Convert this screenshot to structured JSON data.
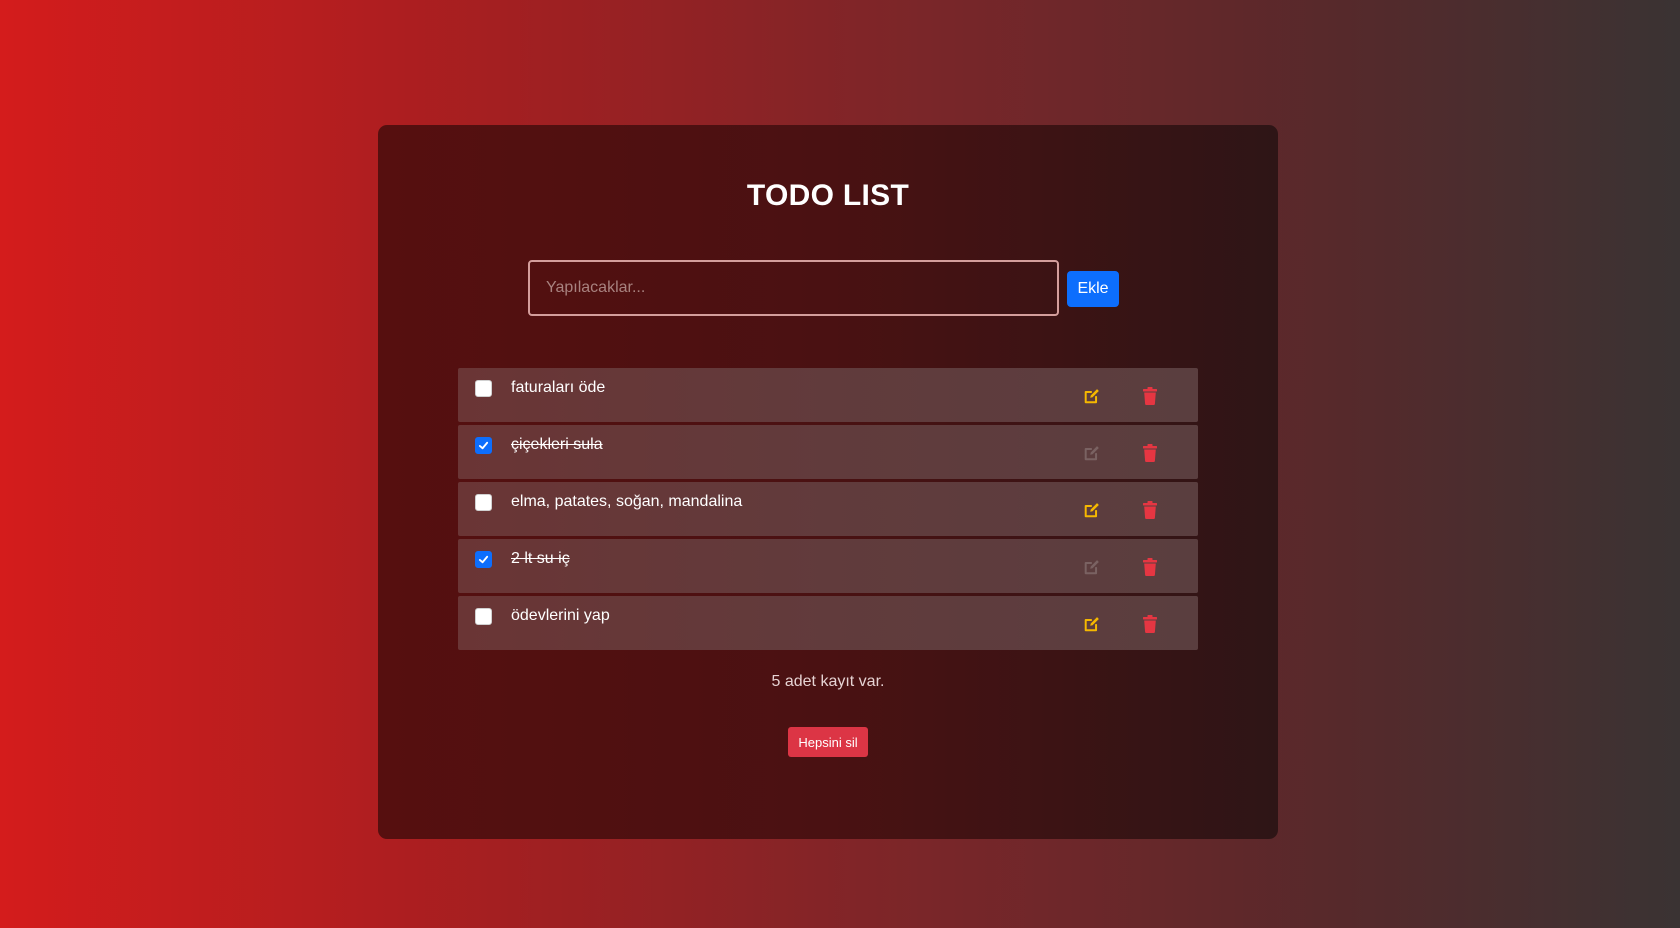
{
  "app": {
    "title": "TODO LIST"
  },
  "input": {
    "placeholder": "Yapılacaklar...",
    "value": ""
  },
  "add_button": {
    "label": "Ekle"
  },
  "todos": [
    {
      "text": "faturaları öde",
      "done": false
    },
    {
      "text": "çiçekleri sula",
      "done": true
    },
    {
      "text": "elma, patates, soğan, mandalina",
      "done": false
    },
    {
      "text": "2 lt su iç",
      "done": true
    },
    {
      "text": "ödevlerini yap",
      "done": false
    }
  ],
  "footer": {
    "count_text": "5 adet kayıt var.",
    "clear_label": "Hepsini sil"
  },
  "colors": {
    "edit_active": "#f5b800",
    "edit_disabled": "#7a6262",
    "delete": "#e53642",
    "primary": "#0d6efd",
    "danger": "#dc3545"
  },
  "icons": {
    "edit": "edit-icon",
    "delete": "trash-icon",
    "check": "check-icon"
  }
}
